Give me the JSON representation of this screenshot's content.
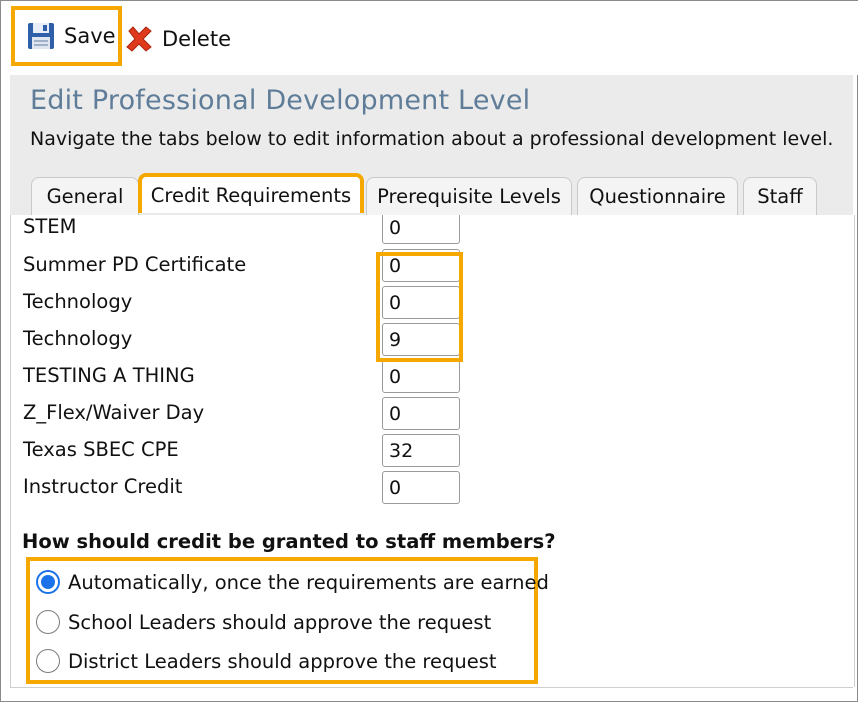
{
  "toolbar": {
    "save_label": "Save",
    "delete_label": "Delete",
    "save_icon": "floppy-disk-icon",
    "delete_icon": "red-x-icon"
  },
  "header": {
    "title": "Edit Professional Development Level",
    "description": "Navigate the tabs below to edit information about a professional development level."
  },
  "tabs": [
    {
      "label": "General"
    },
    {
      "label": "Credit Requirements",
      "active": true
    },
    {
      "label": "Prerequisite Levels"
    },
    {
      "label": "Questionnaire"
    },
    {
      "label": "Staff"
    }
  ],
  "credits": [
    {
      "label": "STEM",
      "value": "0"
    },
    {
      "label": "Summer PD Certificate",
      "value": "0"
    },
    {
      "label": "Technology",
      "value": "0"
    },
    {
      "label": "Technology",
      "value": "9"
    },
    {
      "label": "TESTING A THING",
      "value": "0"
    },
    {
      "label": "Z_Flex/Waiver Day",
      "value": "0"
    },
    {
      "label": "Texas SBEC CPE",
      "value": "32"
    },
    {
      "label": "Instructor Credit",
      "value": "0"
    }
  ],
  "grant": {
    "question": "How should credit be granted to staff members?",
    "options": [
      {
        "label": "Automatically, once the requirements are earned",
        "selected": true
      },
      {
        "label": "School Leaders should approve the request",
        "selected": false
      },
      {
        "label": "District Leaders should approve the request",
        "selected": false
      }
    ]
  },
  "colors": {
    "highlight": "#f5a800",
    "title": "#5f7d98",
    "header_bg": "#ebebeb",
    "radio_selected": "#1a73e8"
  }
}
